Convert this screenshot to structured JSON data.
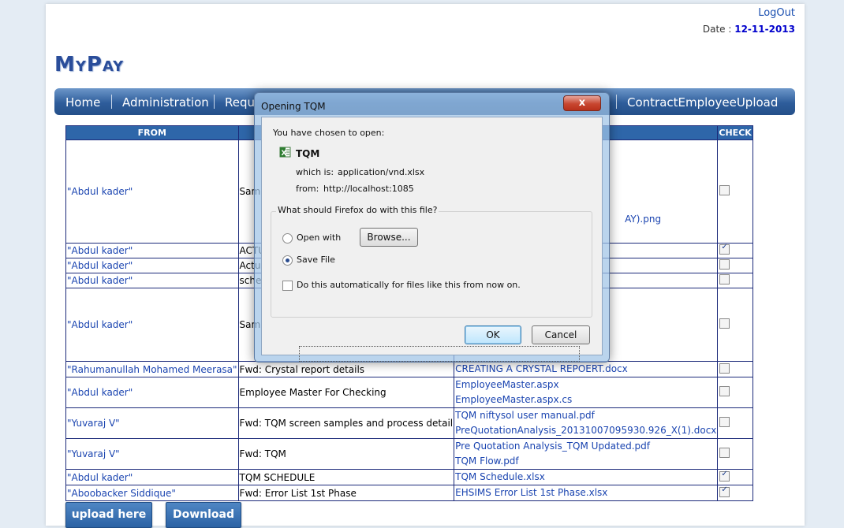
{
  "header": {
    "logout": "LogOut",
    "date_label": "Date :",
    "date_value": "12-11-2013",
    "logo": "MyPay"
  },
  "nav": {
    "items": [
      "Home",
      "Administration",
      "Requ",
      "ContractEmployeeUpload"
    ]
  },
  "table": {
    "headers": {
      "from": "FROM",
      "check": "CHECK"
    },
    "rows": [
      {
        "from": "\"Abdul kader\"",
        "subject": "Samp",
        "attachments": [
          "",
          "AY).png"
        ],
        "checked": false
      },
      {
        "from": "\"Abdul kader\"",
        "subject": "ACTU",
        "attachments": [],
        "checked": true
      },
      {
        "from": "\"Abdul kader\"",
        "subject": "Actua",
        "attachments": [],
        "checked": false
      },
      {
        "from": "\"Abdul kader\"",
        "subject": "sched",
        "attachments": [],
        "checked": false
      },
      {
        "from": "\"Abdul kader\"",
        "subject": "Samp",
        "attachments": [],
        "checked": false
      },
      {
        "from": "\"Rahumanullah Mohamed Meerasa\"",
        "subject": "Fwd: Crystal report details",
        "attachments": [
          "CREATING A CRYSTAL REPOERT.docx"
        ],
        "checked": false
      },
      {
        "from": "\"Abdul kader\"",
        "subject": "Employee Master For Checking",
        "attachments": [
          "EmployeeMaster.aspx",
          "EmployeeMaster.aspx.cs"
        ],
        "checked": false
      },
      {
        "from": "\"Yuvaraj V\"",
        "subject": "Fwd: TQM screen samples and process detail",
        "attachments": [
          "TQM niftysol user manual.pdf",
          "PreQuotationAnalysis_20131007095930.926_X(1).docx"
        ],
        "checked": false
      },
      {
        "from": "\"Yuvaraj V\"",
        "subject": "Fwd: TQM",
        "attachments": [
          "Pre Quotation Analysis_TQM Updated.pdf",
          "TQM Flow.pdf"
        ],
        "checked": false
      },
      {
        "from": "\"Abdul kader\"",
        "subject": "TQM SCHEDULE",
        "attachments": [
          "TQM Schedule.xlsx"
        ],
        "checked": true
      },
      {
        "from": "\"Aboobacker Siddique\"",
        "subject": "Fwd: Error List 1st Phase",
        "attachments": [
          "EHSIMS Error List 1st Phase.xlsx"
        ],
        "checked": true
      }
    ]
  },
  "buttons": {
    "upload": "upload here",
    "download": "Download"
  },
  "dialog": {
    "title": "Opening TQM",
    "close": "x",
    "intro": "You have chosen to open:",
    "file_name": "TQM",
    "which_is_label": "which is:",
    "which_is_value": "application/vnd.xlsx",
    "from_label": "from:",
    "from_value": "http://localhost:1085",
    "question": "What should Firefox do with this file?",
    "open_with": "Open with",
    "browse": "Browse...",
    "save_file": "Save File",
    "auto": "Do this automatically for files like this from now on.",
    "ok": "OK",
    "cancel": "Cancel",
    "selected_option": "save_file"
  }
}
